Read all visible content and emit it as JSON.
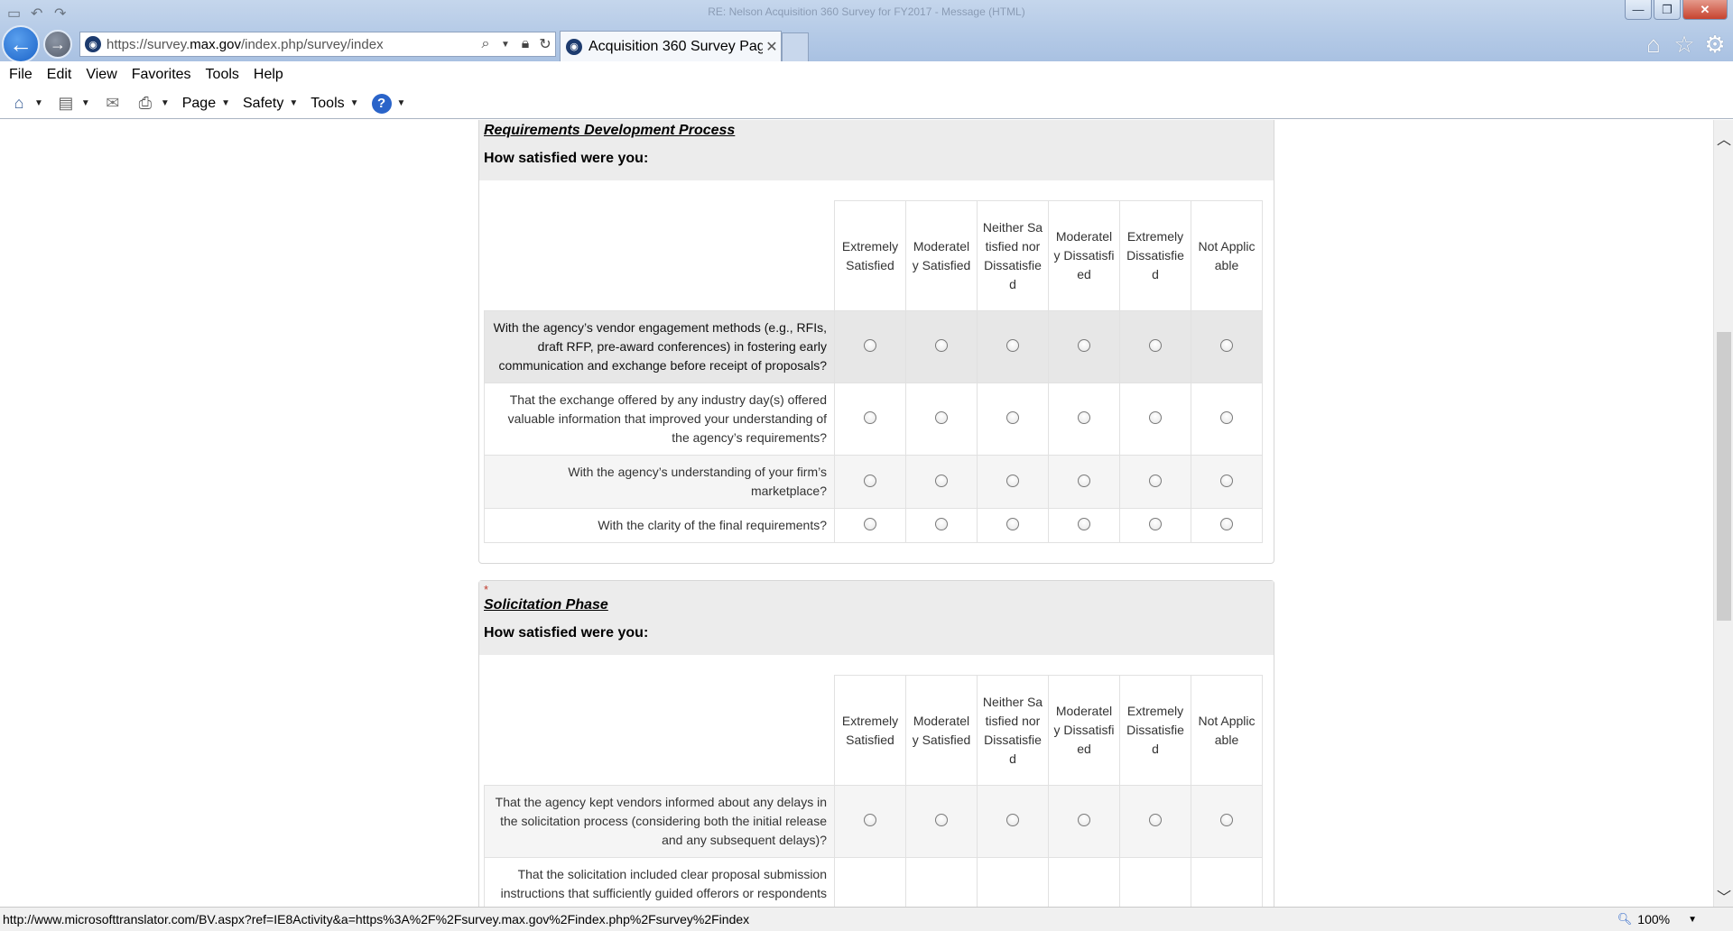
{
  "browser": {
    "window_title": "RE: Nelson Acquisition 360 Survey for FY2017 - Message (HTML)",
    "url_prefix": "https://survey.",
    "url_domain": "max.gov",
    "url_path": "/index.php/survey/index",
    "tab_title": "Acquisition 360 Survey Pag...",
    "window_buttons": {
      "minimize": "—",
      "restore": "❐",
      "close": "✕"
    }
  },
  "menu": [
    "File",
    "Edit",
    "View",
    "Favorites",
    "Tools",
    "Help"
  ],
  "command_bar": {
    "page": "Page",
    "safety": "Safety",
    "tools": "Tools",
    "help": "?"
  },
  "columns": [
    "Extremely Satisfied",
    "Moderately Satisfied",
    "Neither Satisfied nor Dissatisfied",
    "Moderately Dissatisfied",
    "Extremely Dissatisfied",
    "Not Applicable"
  ],
  "sections": [
    {
      "title": "Requirements Development Process",
      "subtitle": "How satisfied were you:",
      "questions": [
        "With the agency’s vendor engagement methods (e.g., RFIs, draft RFP, pre-award conferences) in fostering early communication and exchange before receipt of proposals?",
        "That the exchange offered by any industry day(s) offered valuable information that improved your understanding of the agency’s requirements?",
        "With the agency’s understanding of your firm’s marketplace?",
        "With the clarity of the final requirements?"
      ]
    },
    {
      "required_mark": "*",
      "title": "Solicitation Phase",
      "subtitle": "How satisfied were you:",
      "questions": [
        "That the agency kept vendors informed about any delays in the solicitation process (considering both the initial release and any subsequent delays)?",
        "That the solicitation included clear proposal submission instructions that sufficiently guided offerors or respondents"
      ]
    }
  ],
  "status": {
    "url": "http://www.microsofttranslator.com/BV.aspx?ref=IE8Activity&a=https%3A%2F%2Fsurvey.max.gov%2Findex.php%2Fsurvey%2Findex",
    "zoom": "100%"
  }
}
